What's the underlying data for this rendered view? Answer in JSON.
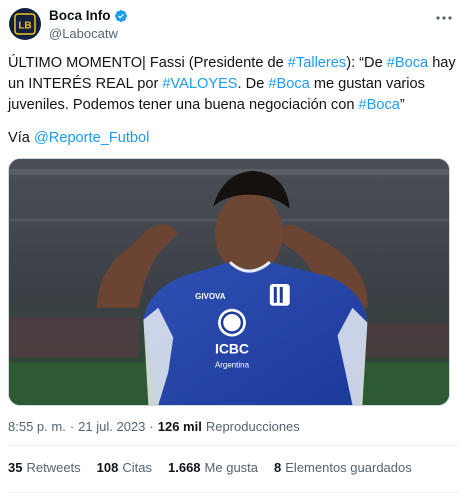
{
  "author": {
    "display_name": "Boca Info",
    "handle": "@Labocatw",
    "avatar_label": "LB"
  },
  "tweet": {
    "segments": [
      {
        "text": "ÚLTIMO MOMENTO| Fassi (Presidente de ",
        "link": false
      },
      {
        "text": "#Talleres",
        "link": true
      },
      {
        "text": "): “De ",
        "link": false
      },
      {
        "text": "#Boca",
        "link": true
      },
      {
        "text": " hay un INTERÉS REAL por ",
        "link": false
      },
      {
        "text": "#VALOYES",
        "link": true
      },
      {
        "text": ". De ",
        "link": false
      },
      {
        "text": "#Boca",
        "link": true
      },
      {
        "text": " me gustan varios juveniles. Podemos tener una buena negociación con ",
        "link": false
      },
      {
        "text": "#Boca",
        "link": true
      },
      {
        "text": "”",
        "link": false
      }
    ],
    "via_prefix": "Vía ",
    "via_link": "@Reporte_Futbol"
  },
  "media": {
    "jersey_sponsor": "ICBC",
    "jersey_sponsor_sub": "Argentina",
    "jersey_brand": "GIVOVA"
  },
  "meta": {
    "time": "8:55 p. m.",
    "separator": "·",
    "date": "21 jul. 2023",
    "views_count": "126 mil",
    "views_label": "Reproducciones"
  },
  "stats": {
    "retweets_count": "35",
    "retweets_label": "Retweets",
    "quotes_count": "108",
    "quotes_label": "Citas",
    "likes_count": "1.668",
    "likes_label": "Me gusta",
    "bookmarks_count": "8",
    "bookmarks_label": "Elementos guardados"
  },
  "colors": {
    "link": "#1d9bf0",
    "verified": "#1d9bf0",
    "avatar_bg": "#12213f",
    "avatar_accent": "#f2c318"
  },
  "icons": {
    "verified": "verified-badge-icon",
    "more": "more-options-icon"
  }
}
